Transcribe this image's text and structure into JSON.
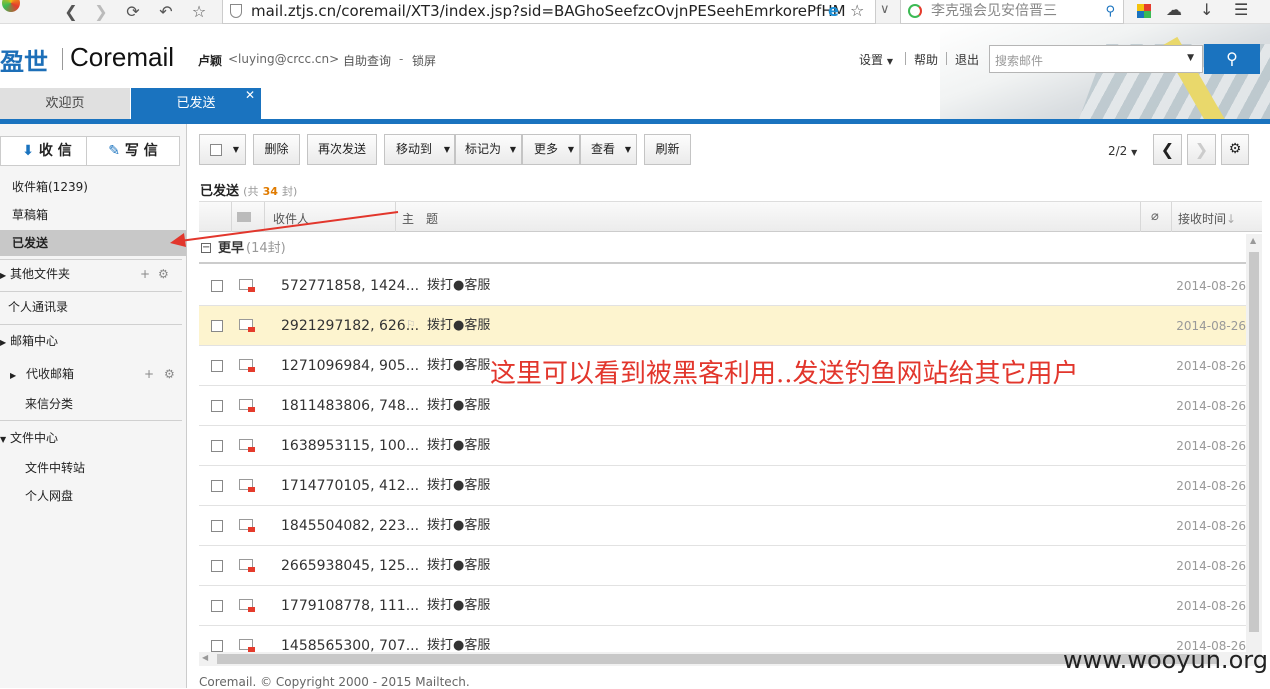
{
  "browser": {
    "url": "mail.ztjs.cn/coremail/XT3/index.jsp?sid=BAGhoSeefzcOvjnPESeehEmrkorePfHM",
    "search_text": "李克强会见安倍晋三"
  },
  "header": {
    "logo_cn": "盈世",
    "logo_en": "Coremail",
    "user_name": "卢颖",
    "user_email": "<luying@crcc.cn>",
    "self_query": "自助查询",
    "dash": "-",
    "lock": "锁屏",
    "settings": "设置",
    "help": "帮助",
    "logout": "退出",
    "search_placeholder": "搜索邮件"
  },
  "tabs": [
    {
      "label": "欢迎页"
    },
    {
      "label": "已发送"
    }
  ],
  "sidebar": {
    "receive": "收 信",
    "compose": "写 信",
    "inbox": "收件箱(1239)",
    "drafts": "草稿箱",
    "sent": "已发送",
    "other_folders": "其他文件夹",
    "contacts": "个人通讯录",
    "mailbox_center": "邮箱中心",
    "proxy_mail": "代收邮箱",
    "mail_sort": "来信分类",
    "file_center": "文件中心",
    "file_transfer": "文件中转站",
    "netdisk": "个人网盘"
  },
  "toolbar": {
    "delete": "删除",
    "resend": "再次发送",
    "move_to": "移动到",
    "mark_as": "标记为",
    "more": "更多",
    "view": "查看",
    "refresh": "刷新",
    "page": "2/2"
  },
  "list": {
    "folder_title": "已发送",
    "count_prefix": "(共",
    "count": "34",
    "count_suffix": "封)",
    "col_recipient": "收件人",
    "col_subject": "主　题",
    "col_time": "接收时间",
    "group_label": "更早",
    "group_count": "(14封)",
    "rows": [
      {
        "recipient": "572771858, 1424...",
        "subject": "拨打●客服",
        "date": "2014-08-26"
      },
      {
        "recipient": "2921297182, 626...",
        "subject": "拨打●客服",
        "date": "2014-08-26"
      },
      {
        "recipient": "1271096984, 905...",
        "subject": "拨打●客服",
        "date": "2014-08-26"
      },
      {
        "recipient": "1811483806, 748...",
        "subject": "拨打●客服",
        "date": "2014-08-26"
      },
      {
        "recipient": "1638953115, 100...",
        "subject": "拨打●客服",
        "date": "2014-08-26"
      },
      {
        "recipient": "1714770105, 412...",
        "subject": "拨打●客服",
        "date": "2014-08-26"
      },
      {
        "recipient": "1845504082, 223...",
        "subject": "拨打●客服",
        "date": "2014-08-26"
      },
      {
        "recipient": "2665938045, 125...",
        "subject": "拨打●客服",
        "date": "2014-08-26"
      },
      {
        "recipient": "1779108778, 111...",
        "subject": "拨打●客服",
        "date": "2014-08-26"
      },
      {
        "recipient": "1458565300, 707...",
        "subject": "拨打●客服",
        "date": "2014-08-26"
      }
    ]
  },
  "annotation": "这里可以看到被黑客利用..发送钓鱼网站给其它用户",
  "footer": "Coremail. © Copyright 2000 - 2015 Mailtech.",
  "watermark": "www.wooyun.org",
  "colors": {
    "accent": "#1a73bf",
    "highlight_row": "#fdf4cf",
    "annotation": "#e2362c"
  }
}
